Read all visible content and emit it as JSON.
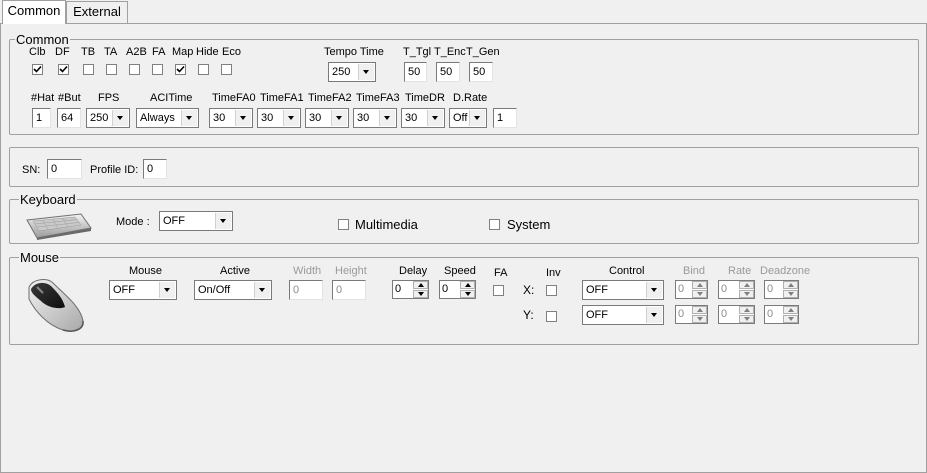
{
  "tabs": [
    "Common",
    "External"
  ],
  "common": {
    "title": "Common",
    "flag_labels": [
      "Clb",
      "DF",
      "TB",
      "TA",
      "A2B",
      "FA",
      "Map",
      "Hide",
      "Eco"
    ],
    "flag_checked": [
      true,
      true,
      false,
      false,
      false,
      false,
      true,
      false,
      false
    ],
    "tempo_label": "Tempo Time",
    "tempo_value": "250",
    "t_tgl_label": "T_Tgl",
    "t_tgl_value": "50",
    "t_enc_label": "T_Enc",
    "t_enc_value": "50",
    "t_gen_label": "T_Gen",
    "t_gen_value": "50",
    "hat_label": "#Hat",
    "hat_value": "1",
    "but_label": "#But",
    "but_value": "64",
    "fps_label": "FPS",
    "fps_value": "250",
    "acltime_label": "ACITime",
    "acltime_value": "Always",
    "timefa0_label": "TimeFA0",
    "timefa0_value": "30",
    "timefa1_label": "TimeFA1",
    "timefa1_value": "30",
    "timefa2_label": "TimeFA2",
    "timefa2_value": "30",
    "timefa3_label": "TimeFA3",
    "timefa3_value": "30",
    "timedr_label": "TimeDR",
    "timedr_value": "30",
    "drate_label": "D.Rate",
    "drate_value": "Off",
    "drate_text": "1"
  },
  "sn": {
    "sn_label": "SN:",
    "sn_value": "0",
    "profile_label": "Profile ID:",
    "profile_value": "0"
  },
  "keyboard": {
    "title": "Keyboard",
    "mode_label": "Mode :",
    "mode_value": "OFF",
    "multimedia_label": "Multimedia",
    "multimedia_checked": false,
    "system_label": "System",
    "system_checked": false
  },
  "mouse": {
    "title": "Mouse",
    "mouse_label": "Mouse",
    "mouse_value": "OFF",
    "active_label": "Active",
    "active_value": "On/Off",
    "width_label": "Width",
    "width_value": "0",
    "height_label": "Height",
    "height_value": "0",
    "delay_label": "Delay",
    "delay_value": "0",
    "speed_label": "Speed",
    "speed_value": "0",
    "fa_label": "FA",
    "inv_label": "Inv",
    "x_label": "X:",
    "y_label": "Y:",
    "control_label": "Control",
    "control_x_value": "OFF",
    "control_y_value": "OFF",
    "bind_label": "Bind",
    "rate_label": "Rate",
    "deadzone_label": "Deadzone",
    "bind_x": "0",
    "rate_x": "0",
    "deadzone_x": "0",
    "bind_y": "0",
    "rate_y": "0",
    "deadzone_y": "0"
  }
}
